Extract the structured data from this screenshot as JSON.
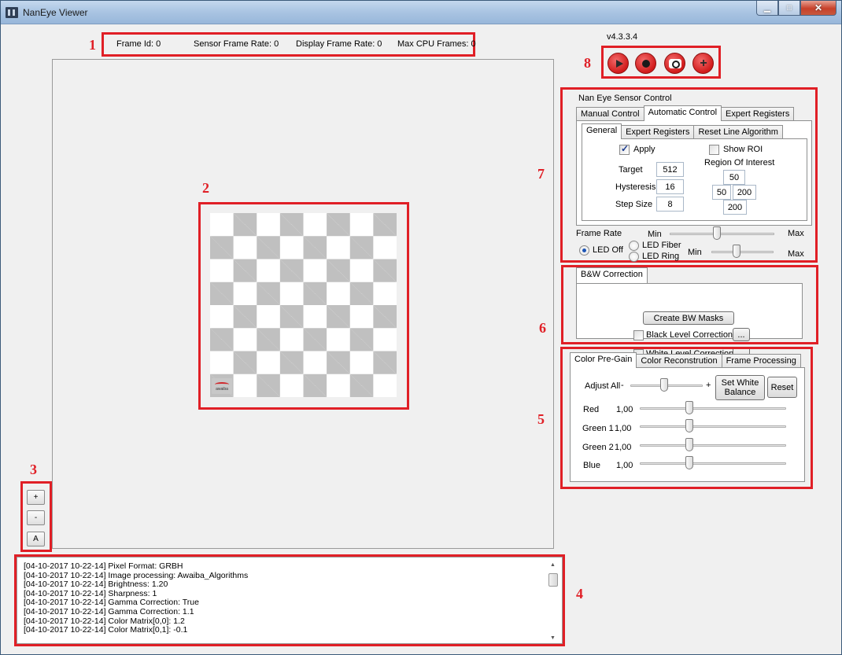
{
  "window": {
    "title": "NanEye Viewer"
  },
  "info_bar": {
    "frame_id": "Frame Id:  0",
    "sensor_frame_rate": "Sensor Frame Rate:  0",
    "display_frame_rate": "Display Frame Rate:  0",
    "max_cpu_frames": "Max CPU Frames: 0"
  },
  "callouts": [
    "1",
    "2",
    "3",
    "4",
    "5",
    "6",
    "7",
    "8"
  ],
  "viewer": {
    "logo_text": "awaiba"
  },
  "zoom": {
    "zoom_in": "+",
    "zoom_out": "-",
    "auto": "A"
  },
  "log": {
    "lines": [
      "[04-10-2017 10-22-14] Pixel Format: GRBH",
      "[04-10-2017 10-22-14] Image processing: Awaiba_Algorithms",
      "[04-10-2017 10-22-14] Brightness: 1.20",
      "[04-10-2017 10-22-14] Sharpness: 1",
      "[04-10-2017 10-22-14] Gamma Correction: True",
      "[04-10-2017 10-22-14] Gamma Correction: 1.1",
      "[04-10-2017 10-22-14] Color Matrix[0,0]: 1.2",
      "[04-10-2017 10-22-14] Color Matrix[0,1]: -0.1"
    ]
  },
  "version": "v4.3.3.4",
  "transport": [
    "play-icon",
    "record-icon",
    "snapshot-icon",
    "add-icon"
  ],
  "sensor_control": {
    "group_label": "Nan Eye Sensor Control",
    "tabs": [
      "Manual Control",
      "Automatic Control",
      "Expert Registers"
    ],
    "active_tab": "Automatic Control",
    "subtabs": [
      "General",
      "Expert Registers",
      "Reset Line Algorithm"
    ],
    "active_subtab": "General",
    "apply_label": "Apply",
    "apply_checked": true,
    "show_roi_label": "Show ROI",
    "show_roi_checked": false,
    "target_label": "Target",
    "target_value": "512",
    "hysteresis_label": "Hysteresis",
    "hysteresis_value": "16",
    "step_size_label": "Step Size",
    "step_size_value": "8",
    "roi_label": "Region Of Interest",
    "roi_top": "50",
    "roi_left": "50",
    "roi_right": "200",
    "roi_bottom": "200",
    "frame_rate_label": "Frame Rate",
    "frame_rate_min": "Min",
    "frame_rate_max": "Max",
    "frame_rate_level": 0.45,
    "led_off": "LED Off",
    "led_fiber": "LED Fiber",
    "led_ring": "LED Ring",
    "led_min": "Min",
    "led_max": "Max",
    "led_level": 0.4
  },
  "bw_correction": {
    "tab": "B&W Correction",
    "create_masks": "Create BW Masks",
    "black_level": "Black Level Correction",
    "white_level": "White Level Correction",
    "browse": "..."
  },
  "color": {
    "tabs": [
      "Color Pre-Gain",
      "Color Reconstrution",
      "Frame Processing"
    ],
    "active_tab": "Color Pre-Gain",
    "adjust_all": "Adjust All",
    "minus": "-",
    "plus": "+",
    "set_white_balance": "Set White Balance",
    "reset": "Reset",
    "channels": [
      {
        "name": "Red",
        "value": "1,00"
      },
      {
        "name": "Green 1",
        "value": "1,00"
      },
      {
        "name": "Green 2",
        "value": "1,00"
      },
      {
        "name": "Blue",
        "value": "1,00"
      }
    ]
  }
}
